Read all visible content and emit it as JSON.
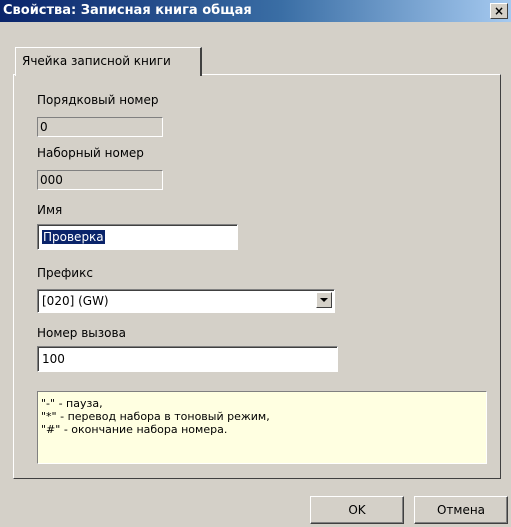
{
  "window": {
    "title": "Свойства: Записная книга общая",
    "close_glyph": "×"
  },
  "tabs": [
    {
      "label": "Ячейка записной книги",
      "active": true
    }
  ],
  "fields": {
    "ordinal": {
      "label": "Порядковый номер",
      "value": "0"
    },
    "dial": {
      "label": "Наборный номер",
      "value": "000"
    },
    "name": {
      "label": "Имя",
      "value": "Проверка"
    },
    "prefix": {
      "label": "Префикс",
      "value": "[020]  (GW)"
    },
    "call_number": {
      "label": "Номер вызова",
      "value": "100"
    }
  },
  "hint": {
    "lines": [
      "\"-\" - пауза,",
      "\"*\" - перевод набора в тоновый режим,",
      "\"#\" - окончание набора номера."
    ]
  },
  "buttons": {
    "ok": "OK",
    "cancel": "Отмена"
  }
}
